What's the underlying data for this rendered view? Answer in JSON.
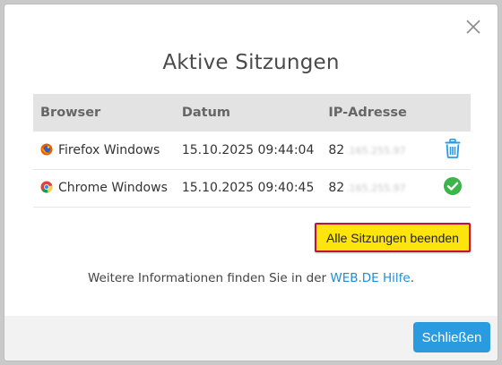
{
  "dialog": {
    "title": "Aktive Sitzungen",
    "close_icon": "close-x-icon"
  },
  "table": {
    "headers": [
      "Browser",
      "Datum",
      "IP-Adresse"
    ],
    "rows": [
      {
        "browser": "Firefox Windows",
        "browser_icon": "firefox-icon",
        "date": "15.10.2025 09:44:04",
        "ip_visible": "82",
        "ip_hidden": ".165.255.97",
        "action_icon": "trash-icon"
      },
      {
        "browser": "Chrome Windows",
        "browser_icon": "chrome-icon",
        "date": "15.10.2025 09:40:45",
        "ip_visible": "82",
        "ip_hidden": ".165.255.97",
        "action_icon": "checkmark-circle-icon"
      }
    ]
  },
  "end_all_button": "Alle Sitzungen beenden",
  "info": {
    "prefix": "Weitere Informationen finden Sie in der ",
    "link": "WEB.DE Hilfe",
    "suffix": "."
  },
  "footer": {
    "close_button": "Schließen"
  },
  "colors": {
    "primary_button": "#2b9be0",
    "highlight_button": "#fde40c",
    "highlight_border": "#c8102e",
    "link": "#1d8ed6",
    "success": "#3ab54a"
  }
}
